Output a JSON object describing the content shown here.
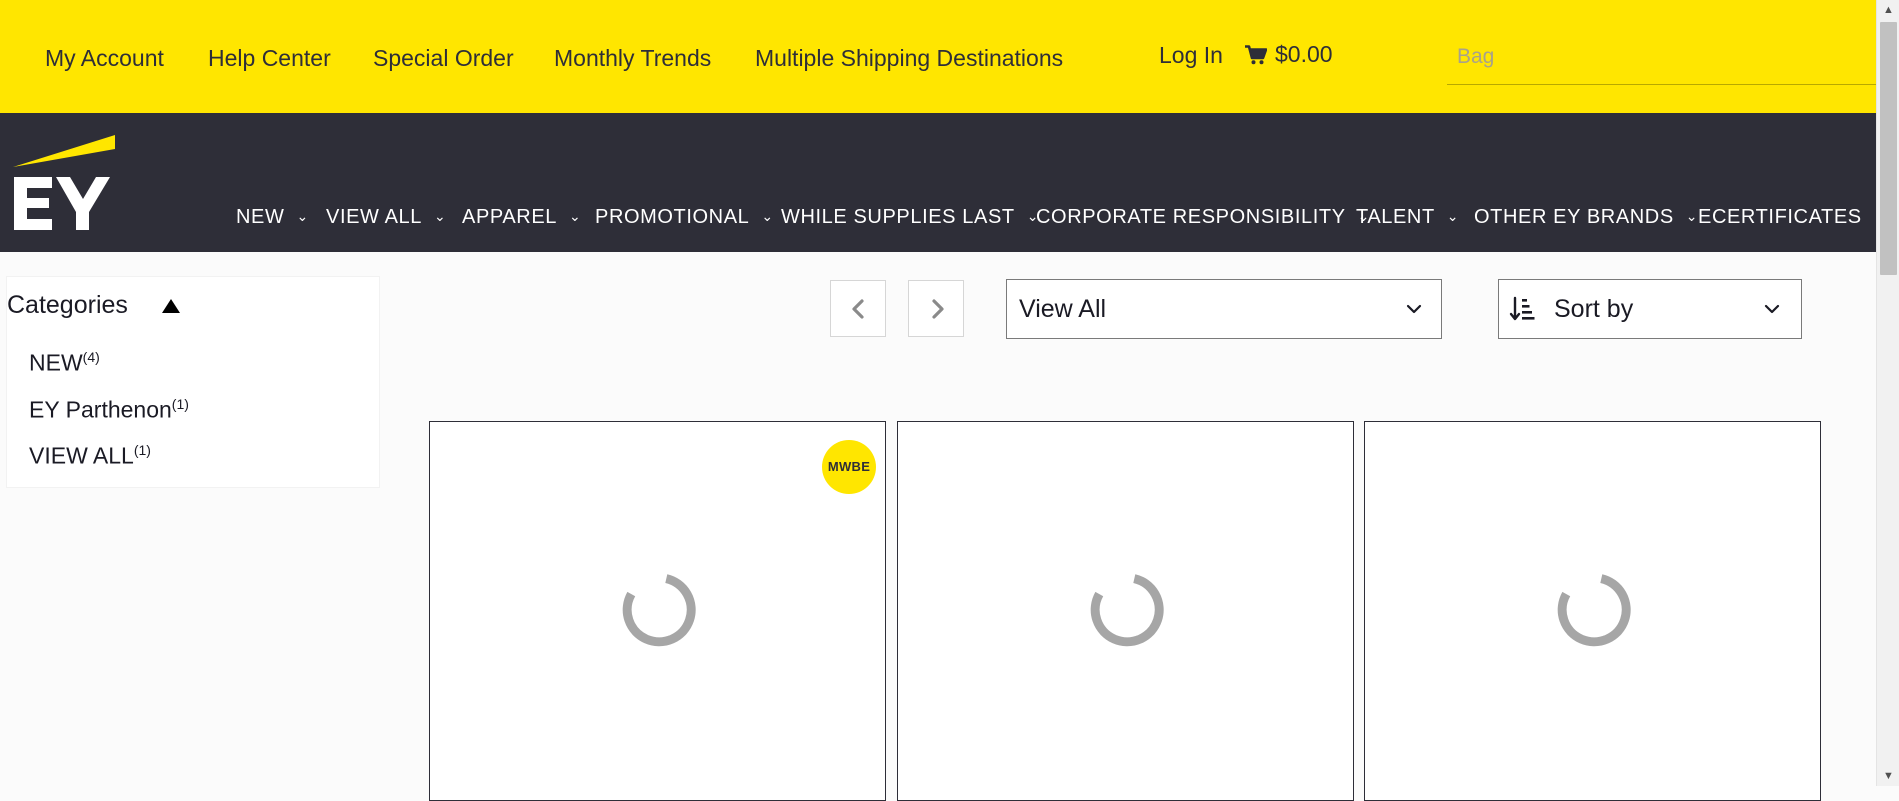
{
  "utility_nav": {
    "links": [
      "My Account",
      "Help Center",
      "Special Order",
      "Monthly Trends",
      "Multiple Shipping Destinations"
    ],
    "login": "Log In",
    "cart_total": "$0.00",
    "search_placeholder": "Bag"
  },
  "brand": {
    "logo_text": "EY",
    "logo_accent_color": "#ffe600",
    "primary_color": "#2e2e38"
  },
  "main_nav": {
    "items": [
      "NEW",
      "VIEW ALL",
      "APPAREL",
      "PROMOTIONAL",
      "WHILE SUPPLIES LAST",
      "CORPORATE RESPONSIBILITY",
      "TALENT",
      "OTHER EY BRANDS",
      "ECERTIFICATES"
    ],
    "dropdown_icon": "chevron-down-icon"
  },
  "sidebar": {
    "title": "Categories",
    "toggle_icon": "triangle-up-icon",
    "categories": [
      {
        "label": "NEW",
        "count": "(4)"
      },
      {
        "label": "EY Parthenon",
        "count": "(1)"
      },
      {
        "label": "VIEW ALL",
        "count": "(1)"
      }
    ]
  },
  "toolbar": {
    "prev_icon": "chevron-left-icon",
    "next_icon": "chevron-right-icon",
    "view_select": "View All",
    "sort_icon": "sort-descending-icon",
    "sort_select": "Sort by"
  },
  "products": [
    {
      "badge": "MWBE",
      "state": "loading"
    },
    {
      "badge": "",
      "state": "loading"
    },
    {
      "badge": "",
      "state": "loading"
    }
  ]
}
